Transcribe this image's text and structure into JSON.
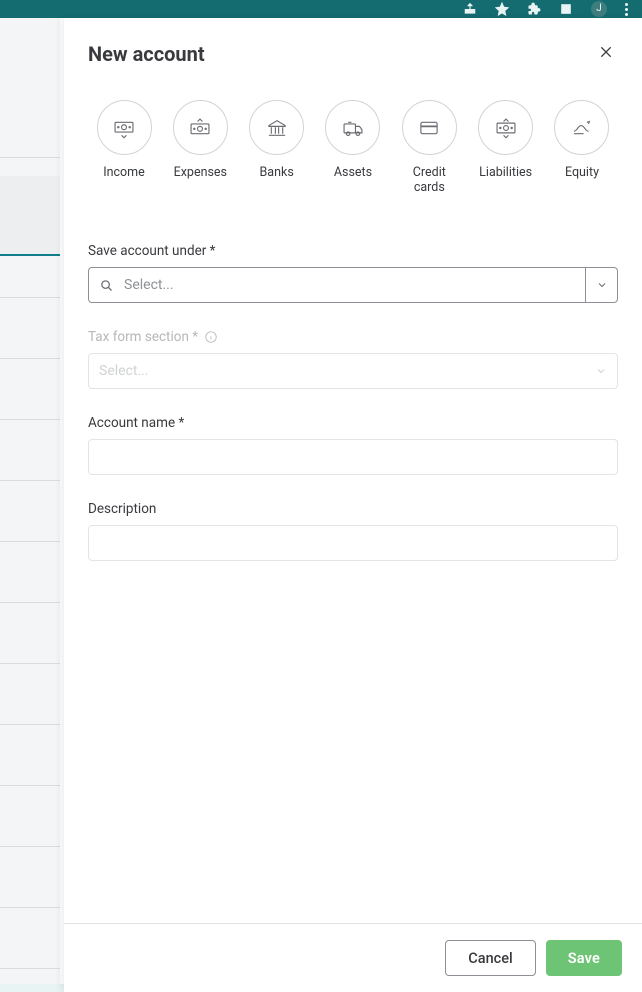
{
  "browser": {
    "avatar_initial": "J"
  },
  "panel": {
    "title": "New account"
  },
  "categories": [
    {
      "key": "income",
      "label": "Income"
    },
    {
      "key": "expenses",
      "label": "Expenses"
    },
    {
      "key": "banks",
      "label": "Banks"
    },
    {
      "key": "assets",
      "label": "Assets"
    },
    {
      "key": "credit-cards",
      "label": "Credit cards"
    },
    {
      "key": "liabilities",
      "label": "Liabilities"
    },
    {
      "key": "equity",
      "label": "Equity"
    }
  ],
  "form": {
    "save_under": {
      "label": "Save account under *",
      "placeholder": "Select...",
      "value": ""
    },
    "tax_section": {
      "label": "Tax form section *",
      "placeholder": "Select...",
      "value": "",
      "disabled": true
    },
    "account_name": {
      "label": "Account name *",
      "value": ""
    },
    "description": {
      "label": "Description",
      "value": ""
    }
  },
  "footer": {
    "cancel": "Cancel",
    "save": "Save"
  }
}
